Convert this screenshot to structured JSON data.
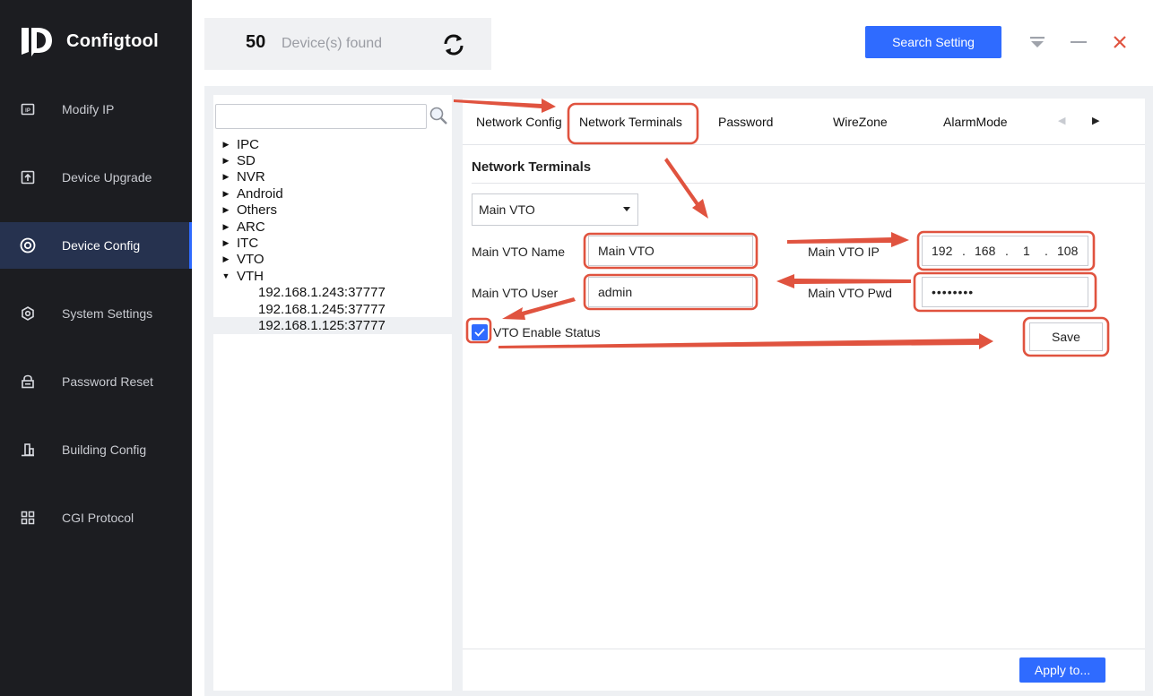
{
  "app": {
    "title": "Configtool"
  },
  "sidebar": {
    "items": [
      {
        "label": "Modify IP",
        "icon": "ip-icon"
      },
      {
        "label": "Device Upgrade",
        "icon": "upload-icon"
      },
      {
        "label": "Device Config",
        "icon": "target-icon",
        "active": true
      },
      {
        "label": "System Settings",
        "icon": "gear-hex-icon"
      },
      {
        "label": "Password Reset",
        "icon": "lock-icon"
      },
      {
        "label": "Building Config",
        "icon": "building-icon"
      },
      {
        "label": "CGI Protocol",
        "icon": "grid-icon"
      }
    ]
  },
  "topbar": {
    "device_count": "50",
    "device_label": "Device(s) found",
    "search_setting_label": "Search Setting"
  },
  "tree": {
    "search_value": "",
    "categories": [
      "IPC",
      "SD",
      "NVR",
      "Android",
      "Others",
      "ARC",
      "ITC",
      "VTO",
      "VTH"
    ],
    "vth_children": [
      "192.168.1.243:37777",
      "192.168.1.245:37777",
      "192.168.1.125:37777"
    ],
    "selected_child": "192.168.1.125:37777"
  },
  "tabs": {
    "items": [
      "Network Config",
      "Network Terminals",
      "Password",
      "WireZone",
      "AlarmMode"
    ],
    "active": "Network Terminals"
  },
  "form": {
    "section_title": "Network Terminals",
    "select_value": "Main VTO",
    "name_label": "Main VTO Name",
    "name_value": "Main VTO",
    "ip_label": "Main VTO IP",
    "ip_segments": [
      "192",
      "168",
      "1",
      "108"
    ],
    "user_label": "Main VTO User",
    "user_value": "admin",
    "pwd_label": "Main VTO Pwd",
    "pwd_mask": "••••••••",
    "enable_label": "VTO Enable Status",
    "enable_checked": true,
    "save_label": "Save",
    "apply_label": "Apply to..."
  },
  "colors": {
    "sidebar_bg": "#1c1d21",
    "active_nav_bg": "#26324f",
    "primary_blue": "#2f6bff",
    "annotation_red": "#e0533f"
  }
}
